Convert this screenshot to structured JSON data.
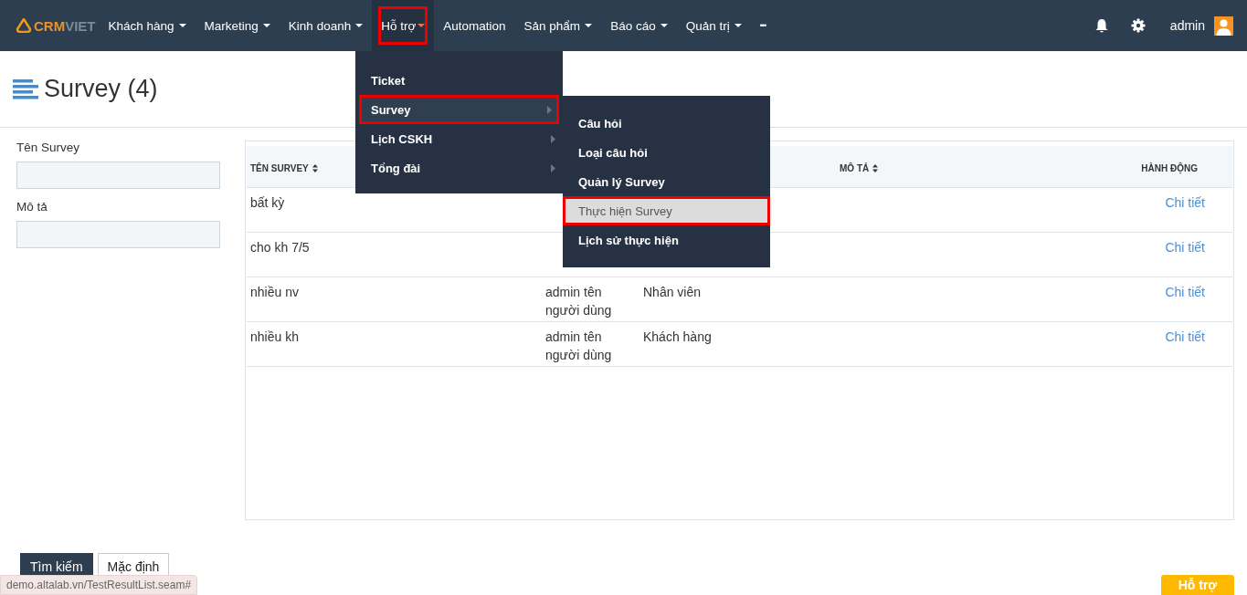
{
  "navbar": {
    "logo": {
      "part_1": "CRM",
      "part_2": "VIET"
    },
    "items": [
      {
        "label": "Khách hàng",
        "caret": true,
        "selected": false,
        "outlined": false
      },
      {
        "label": "Marketing",
        "caret": true,
        "selected": false,
        "outlined": false
      },
      {
        "label": "Kinh doanh",
        "caret": true,
        "selected": false,
        "outlined": false
      },
      {
        "label": "Hỗ trợ",
        "caret": true,
        "selected": true,
        "outlined": true
      },
      {
        "label": "Automation",
        "caret": false,
        "selected": false,
        "outlined": false
      },
      {
        "label": "Sản phẩm",
        "caret": true,
        "selected": false,
        "outlined": false
      },
      {
        "label": "Báo cáo",
        "caret": true,
        "selected": false,
        "outlined": false
      },
      {
        "label": "Quản trị",
        "caret": true,
        "selected": false,
        "outlined": false
      }
    ],
    "more": "•••",
    "user": "admin"
  },
  "menu": [
    {
      "label": "Ticket",
      "submenu": false,
      "selected": false,
      "outlined": false
    },
    {
      "label": "Survey",
      "submenu": true,
      "selected": true,
      "outlined": true
    },
    {
      "label": "Lịch CSKH",
      "submenu": true,
      "selected": false,
      "outlined": false
    },
    {
      "label": "Tổng đài",
      "submenu": true,
      "selected": false,
      "outlined": false
    }
  ],
  "submenu": [
    {
      "label": "Câu hỏi",
      "selected": false,
      "outlined": false
    },
    {
      "label": "Loại câu hỏi",
      "selected": false,
      "outlined": false
    },
    {
      "label": "Quản lý Survey",
      "selected": false,
      "outlined": false
    },
    {
      "label": "Thực hiện Survey",
      "selected": true,
      "outlined": true
    },
    {
      "label": "Lịch sử thực hiện",
      "selected": false,
      "outlined": false
    }
  ],
  "page_title": "Survey (4)",
  "filters": [
    {
      "label": "Tên Survey"
    },
    {
      "label": "Mô tả"
    }
  ],
  "table": {
    "columns": [
      {
        "label": "TÊN SURVEY",
        "sortable": true
      },
      {},
      {},
      {
        "label": "MÔ TẢ",
        "sortable": true
      },
      {
        "label": "HÀNH ĐỘNG",
        "sortable": false
      }
    ],
    "rows": [
      {
        "name": "bất kỳ",
        "action": "Chi tiết"
      },
      {
        "name": "cho kh 7/5",
        "action": "Chi tiết"
      },
      {
        "name": "nhiều nv",
        "column_2": "admin tên người dùng",
        "column_3": "Nhân viên",
        "action": "Chi tiết"
      },
      {
        "name": "nhiều kh",
        "column_2": "admin tên người dùng",
        "column_3": "Khách hàng",
        "action": "Chi tiết"
      }
    ]
  },
  "buttons": [
    {
      "label": "Tìm kiếm",
      "kind": "primary"
    },
    {
      "label": "Mặc định",
      "kind": "default"
    }
  ],
  "status_url": "demo.altalab.vn/TestResultList.seam#",
  "help_button": "Hỗ trợ"
}
